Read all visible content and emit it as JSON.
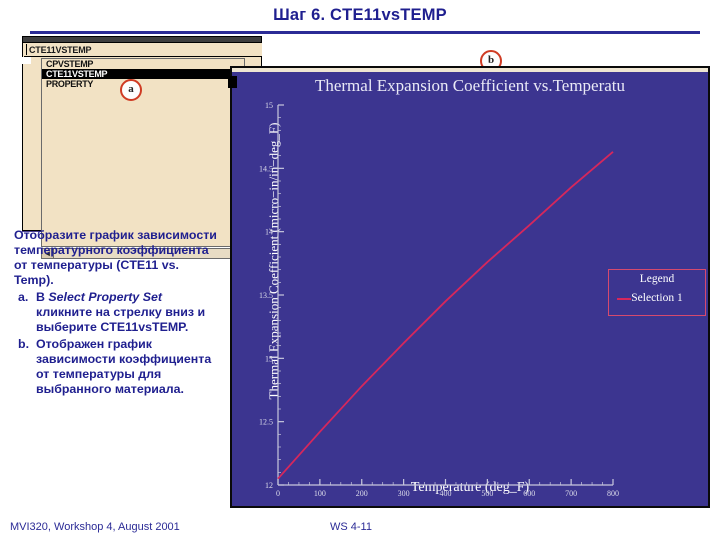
{
  "slide": {
    "title": "Шаг 6.  CTE11vsTEMP",
    "footer_left": "MVI320, Workshop 4, August 2001",
    "footer_center": "WS 4-11"
  },
  "callouts": {
    "a": "a",
    "b": "b"
  },
  "combo": {
    "field_value": "CTE11VSTEMP",
    "items": [
      {
        "label": "CPVSTEMP",
        "selected": false
      },
      {
        "label": "CTE11VSTEMP",
        "selected": true
      },
      {
        "label": "PROPERTY",
        "selected": false
      }
    ],
    "scroll_left_arrow": "◄"
  },
  "instructions": {
    "lead": "Отобразите график зависимости температурного коэффициента от температуры (CTE11 vs. Temp).",
    "items": [
      {
        "marker": "a.",
        "pre": "В ",
        "italic": "Select Property Set",
        "mid": " кликните на стрелку вниз и выберите ",
        "bold": "CTE11vsTEMP",
        "post": "."
      },
      {
        "marker": "b.",
        "pre": "Отображен график зависимости коэффициента от температуры для выбранного материала.",
        "italic": "",
        "mid": "",
        "bold": "",
        "post": ""
      }
    ]
  },
  "chart_data": {
    "type": "line",
    "title": "Thermal Expansion Coefficient vs.Temperatu",
    "xlabel": "Temperature (deg_F)",
    "ylabel": "Thermal Expansion Coefficient (micro−in/in−deg_F)",
    "xlim": [
      0,
      800
    ],
    "ylim": [
      12,
      15
    ],
    "xticks": [
      0,
      100,
      200,
      300,
      400,
      500,
      600,
      700,
      800
    ],
    "yticks": [
      12,
      12.5,
      13,
      13.5,
      14,
      14.5,
      15
    ],
    "grid": false,
    "legend_position": "inside-right",
    "legend_title": "Legend",
    "series": [
      {
        "name": "Selection 1",
        "color": "#d6275c",
        "x": [
          0,
          100,
          200,
          300,
          400,
          500,
          600,
          700,
          800
        ],
        "values": [
          12.05,
          12.42,
          12.78,
          13.12,
          13.45,
          13.76,
          14.05,
          14.35,
          14.63
        ]
      }
    ],
    "plot_background": "#3c3590",
    "axis_color": "#c8c8dd"
  }
}
